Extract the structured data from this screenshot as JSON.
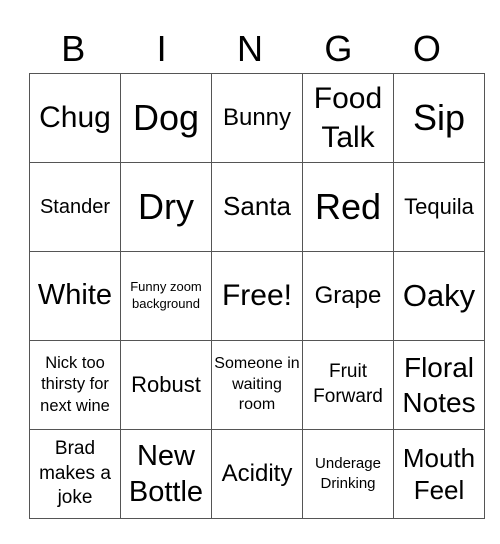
{
  "header": [
    "B",
    "I",
    "N",
    "G",
    "O"
  ],
  "cells": [
    [
      "Chug",
      "Dog",
      "Bunny",
      "Food Talk",
      "Sip"
    ],
    [
      "Stander",
      "Dry",
      "Santa",
      "Red",
      "Tequila"
    ],
    [
      "White",
      "Funny zoom background",
      "Free!",
      "Grape",
      "Oaky"
    ],
    [
      "Nick too thirsty for next wine",
      "Robust",
      "Someone in waiting room",
      "Fruit Forward",
      "Floral Notes"
    ],
    [
      "Brad makes a joke",
      "New Bottle",
      "Acidity",
      "Underage Drinking",
      "Mouth Feel"
    ]
  ]
}
